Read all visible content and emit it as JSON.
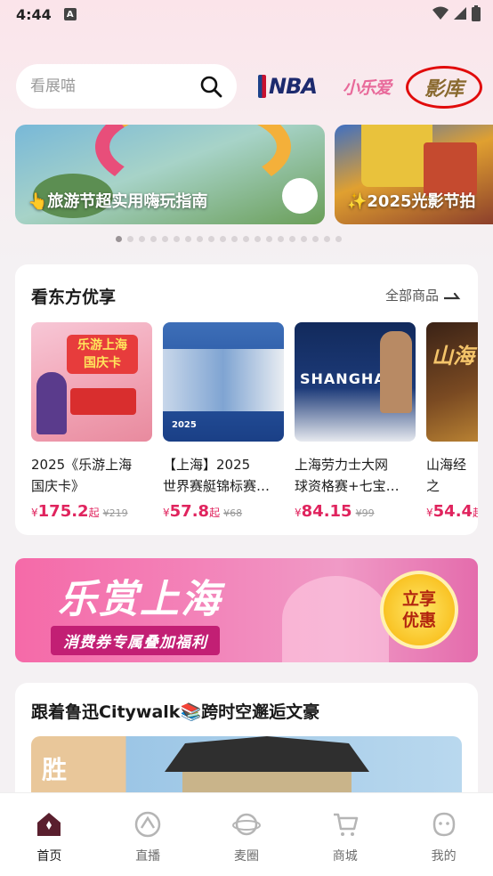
{
  "status_bar": {
    "time": "4:44",
    "notification_letter": "A"
  },
  "search": {
    "placeholder": "看展喵"
  },
  "brands": {
    "nba": "NBA",
    "shuangai": "小乐爱",
    "yingku": "影库"
  },
  "banners": [
    {
      "title": "👆旅游节超实用嗨玩指南"
    },
    {
      "title": "✨2025光影节拍"
    }
  ],
  "carousel": {
    "total": 20,
    "active_index": 0
  },
  "products_section": {
    "title": "看东方优享",
    "all_link": "全部商品",
    "items": [
      {
        "name": "2025《乐游上海\n国庆卡》",
        "symbol": "¥",
        "price": "175.2",
        "suffix": "起",
        "old_price": "¥219",
        "img_text": "乐游上海\n国庆卡"
      },
      {
        "name": "【上海】2025\n世界赛艇锦标赛…",
        "symbol": "¥",
        "price": "57.8",
        "suffix": "起",
        "old_price": "¥68",
        "img_text": "2025"
      },
      {
        "name": "上海劳力士大网\n球资格赛+七宝…",
        "symbol": "¥",
        "price": "84.15",
        "suffix": "",
        "old_price": "¥99",
        "img_text": "SHANGHAI"
      },
      {
        "name": "山海经之\n境 （沉浸",
        "symbol": "¥",
        "price": "54.4",
        "suffix": "起",
        "old_price": "",
        "img_text": "山海"
      }
    ]
  },
  "promo": {
    "title": "乐赏上海",
    "subtitle": "消费券专属叠加福利",
    "badge_line1": "立享",
    "badge_line2": "优惠"
  },
  "citywalk": {
    "title": "跟着鲁迅Citywalk📚跨时空邂逅文豪",
    "img_text": "胜"
  },
  "tabbar": {
    "tabs": [
      {
        "label": "首页",
        "icon": "home-icon",
        "active": true
      },
      {
        "label": "直播",
        "icon": "live-icon",
        "active": false
      },
      {
        "label": "麦圈",
        "icon": "planet-icon",
        "active": false
      },
      {
        "label": "商城",
        "icon": "cart-icon",
        "active": false
      },
      {
        "label": "我的",
        "icon": "profile-icon",
        "active": false
      }
    ]
  },
  "colors": {
    "accent": "#e0245e",
    "brand_red": "#e10b0b",
    "promo_pink": "#f383b9"
  }
}
